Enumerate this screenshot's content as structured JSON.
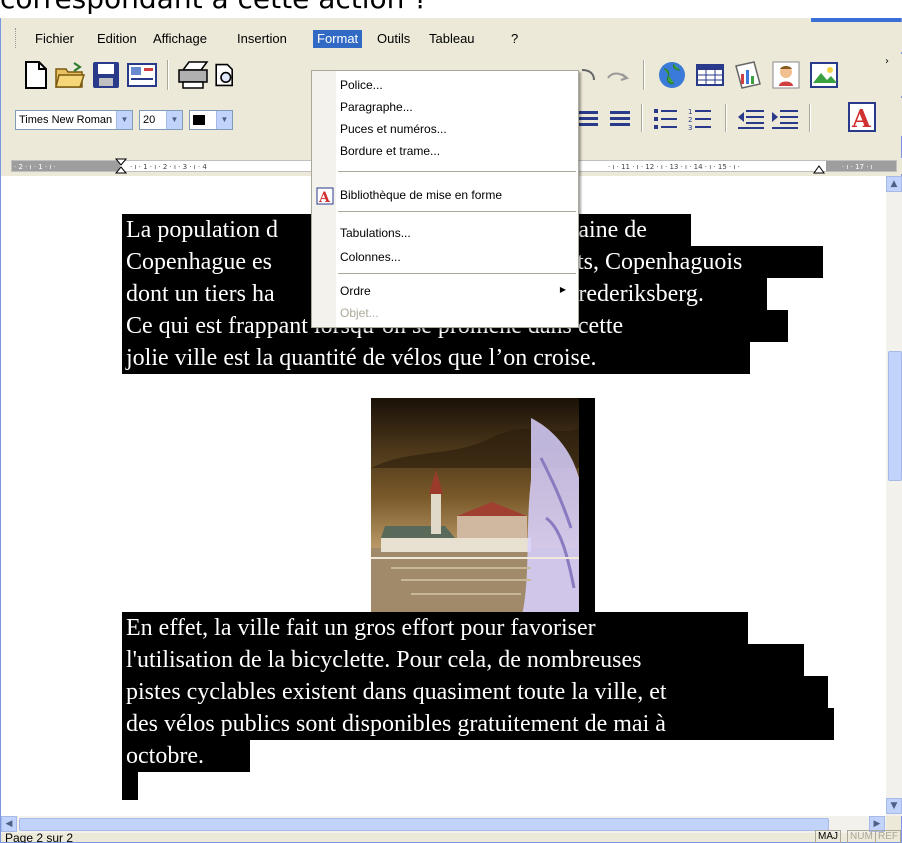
{
  "caption": "correspondant à cette action ?",
  "menubar": {
    "items": [
      "Fichier",
      "Edition",
      "Affichage",
      "Insertion",
      "Format",
      "Outils",
      "Tableau",
      "?"
    ],
    "active": "Format"
  },
  "format_menu": {
    "items": [
      {
        "label": "Police..."
      },
      {
        "label": "Paragraphe..."
      },
      {
        "label": "Puces et numéros..."
      },
      {
        "label": "Bordure et trame..."
      },
      {
        "label": "Bibliothèque de mise en forme"
      },
      {
        "label": "Tabulations..."
      },
      {
        "label": "Colonnes..."
      },
      {
        "label": "Ordre"
      },
      {
        "label": "Objet..."
      }
    ]
  },
  "formatting": {
    "font": "Times New Roman",
    "size": "20"
  },
  "document": {
    "para1": [
      "La population d",
      "Copenhague es",
      "dont un tiers ha",
      "Ce qui est frappant lorsqu’on se promène dans cette",
      "jolie ville est la quantité de vélos que l’on croise."
    ],
    "para1_right": [
      "itaine de",
      "nts, Copenhaguois",
      "Frederiksberg."
    ],
    "para2": [
      "En effet, la ville fait un gros effort pour favoriser",
      "l'utilisation de la bicyclette. Pour cela, de nombreuses",
      "pistes cyclables existent dans quasiment toute la ville, et",
      "des vélos publics sont disponibles gratuitement de mai à",
      "octobre."
    ]
  },
  "status": {
    "page": "Page 2 sur 2",
    "indicators": [
      "MAJ",
      "NUM",
      "REF"
    ]
  },
  "ruler": {
    "left_ticks": "· 2 · ı · 1 · ı ·",
    "ticks": "· ı · 1 · ı · 2 · ı · 3 · ı · 4",
    "right_ticks": "· ı · 11 · ı · 12 · ı · 13 · ı · 14 · ı · 15 · ı ·",
    "far_right": "· ı · 17 · ı"
  },
  "colors": {
    "highlight": "#000000",
    "menu_active": "#316ac5",
    "toolbar_bg": "#ece9d8"
  }
}
